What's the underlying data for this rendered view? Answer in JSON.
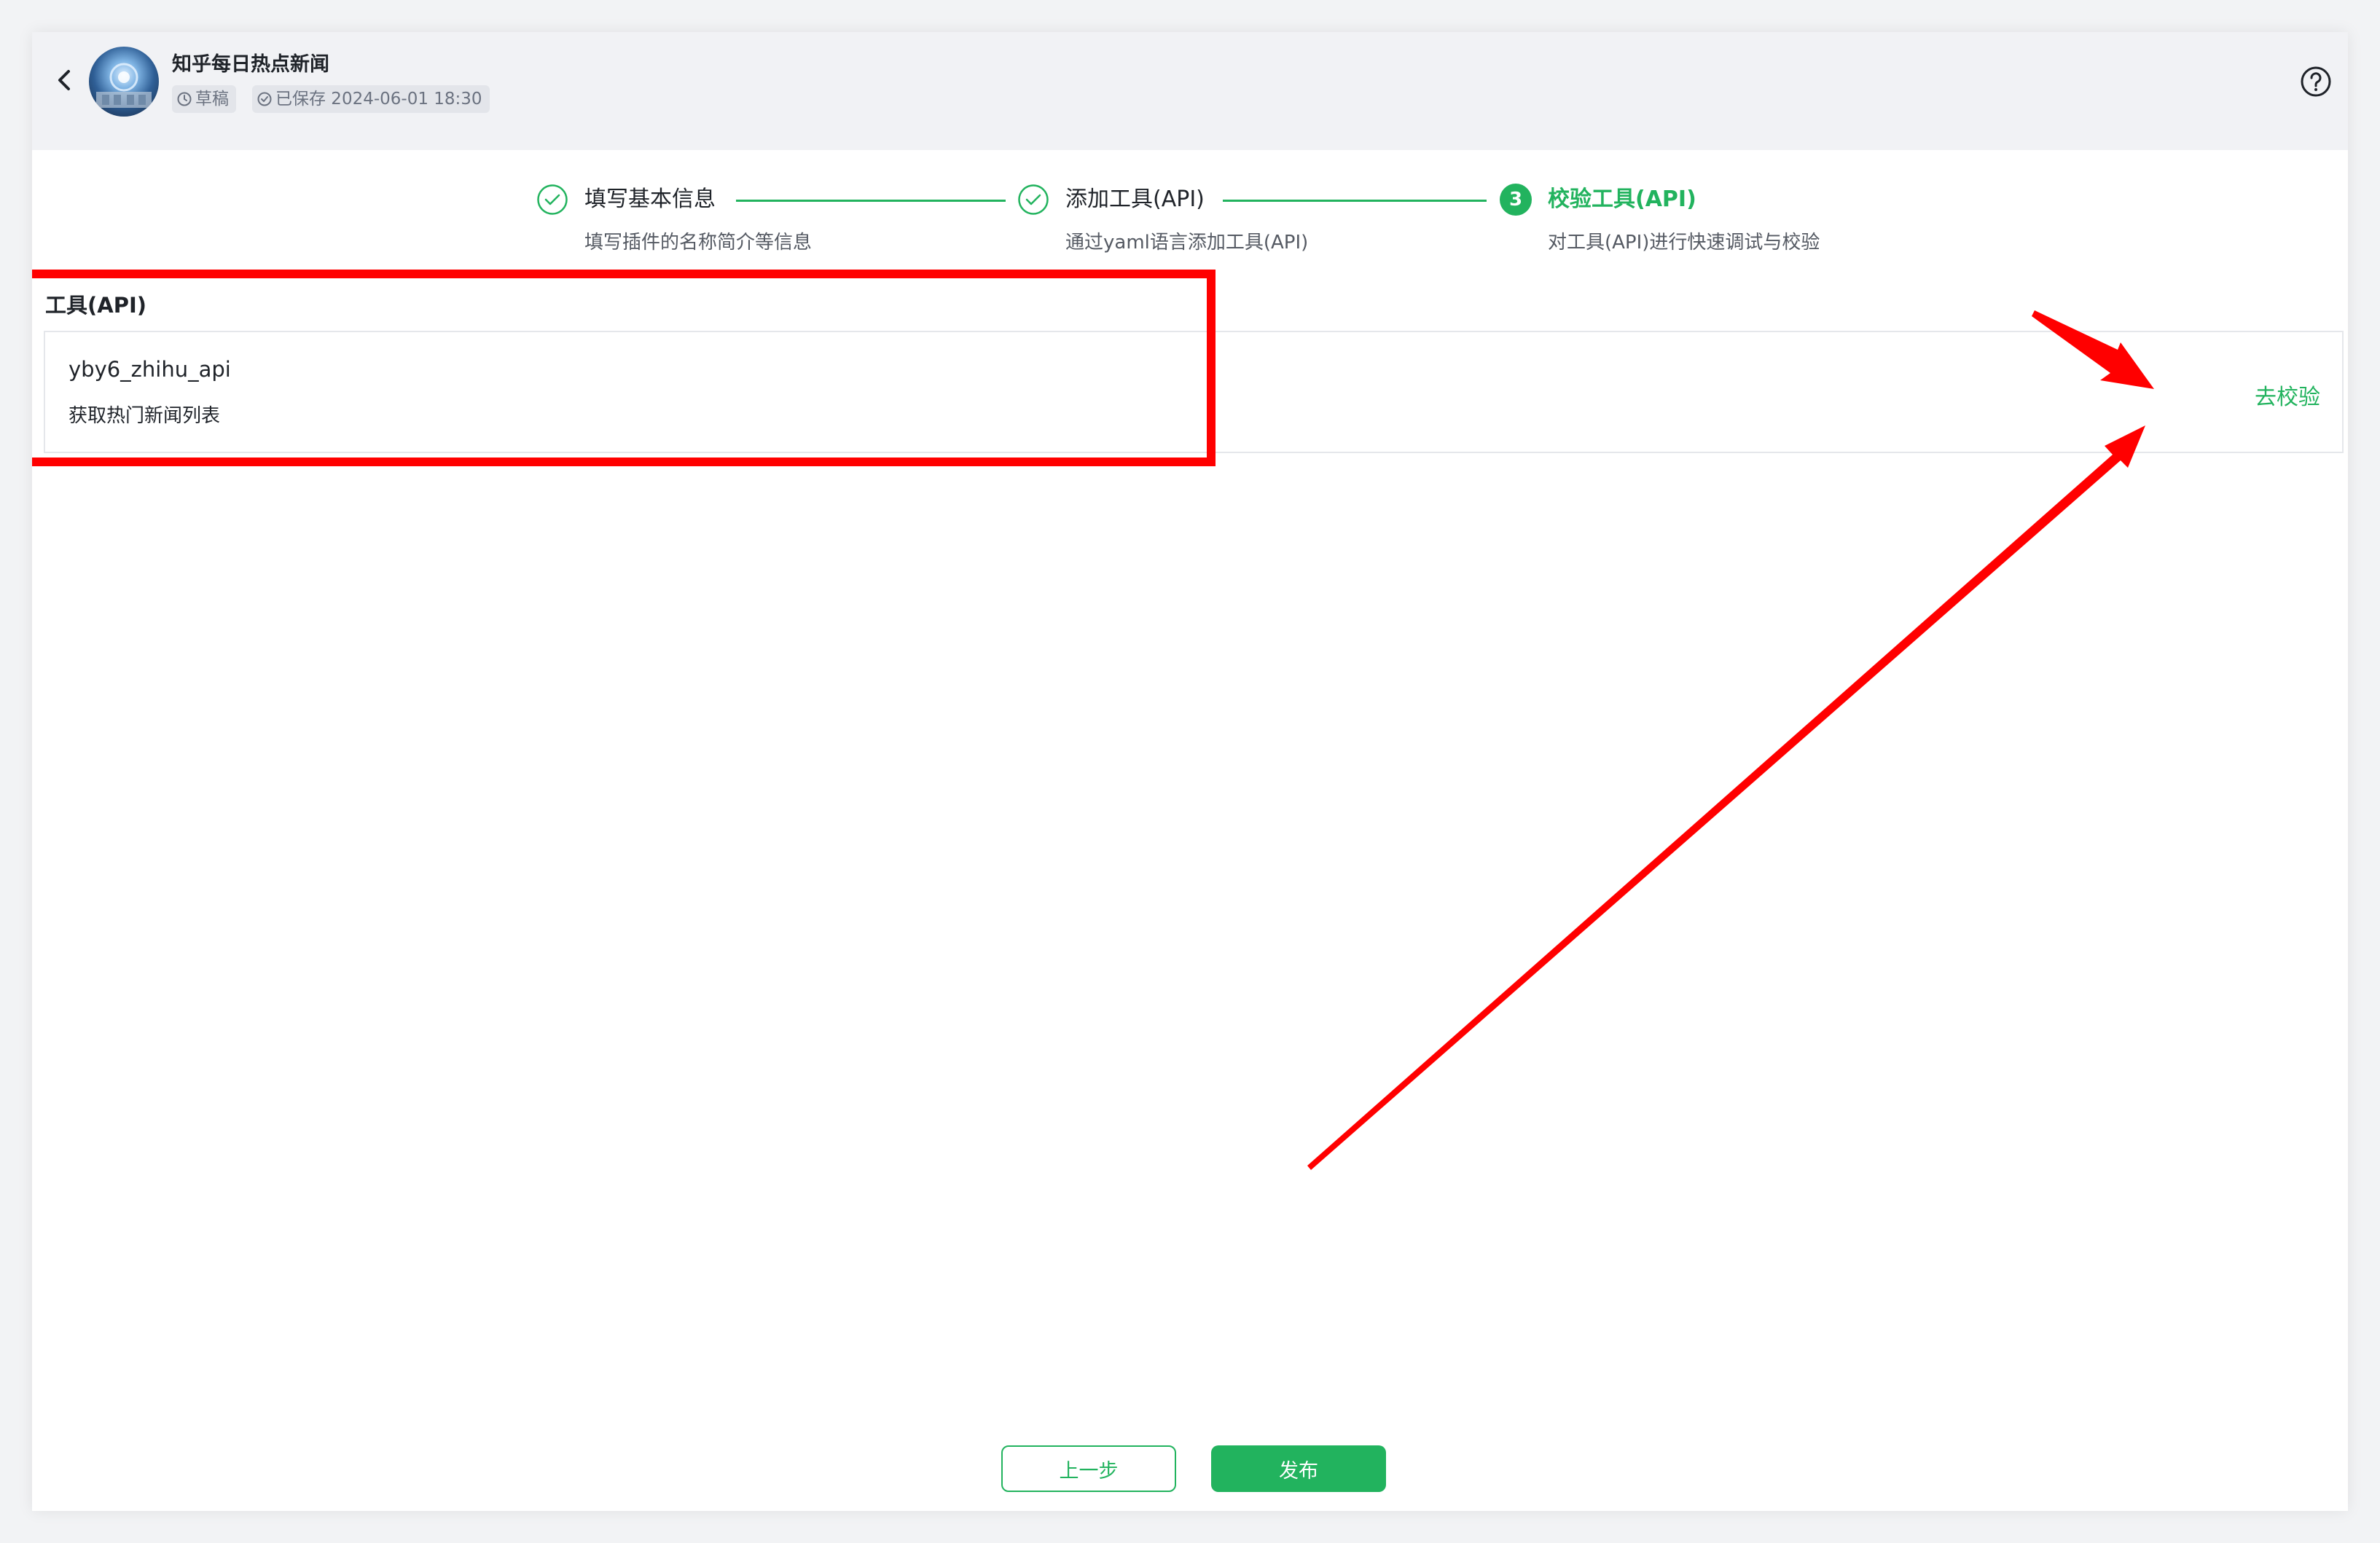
{
  "header": {
    "title": "知乎每日热点新闻",
    "status_draft": "草稿",
    "status_saved": "已保存 2024-06-01 18:30"
  },
  "steps": [
    {
      "title": "填写基本信息",
      "desc": "填写插件的名称简介等信息",
      "state": "done"
    },
    {
      "title": "添加工具(API)",
      "desc": "通过yaml语言添加工具(API)",
      "state": "done"
    },
    {
      "number": "3",
      "title": "校验工具(API)",
      "desc": "对工具(API)进行快速调试与校验",
      "state": "active"
    }
  ],
  "tools_section": {
    "title": "工具(API)",
    "items": [
      {
        "name": "yby6_zhihu_api",
        "desc": "获取热门新闻列表",
        "action": "去校验"
      }
    ]
  },
  "footer": {
    "prev_label": "上一步",
    "publish_label": "发布"
  },
  "colors": {
    "accent": "#22b35e",
    "annotation": "#ff0000"
  }
}
